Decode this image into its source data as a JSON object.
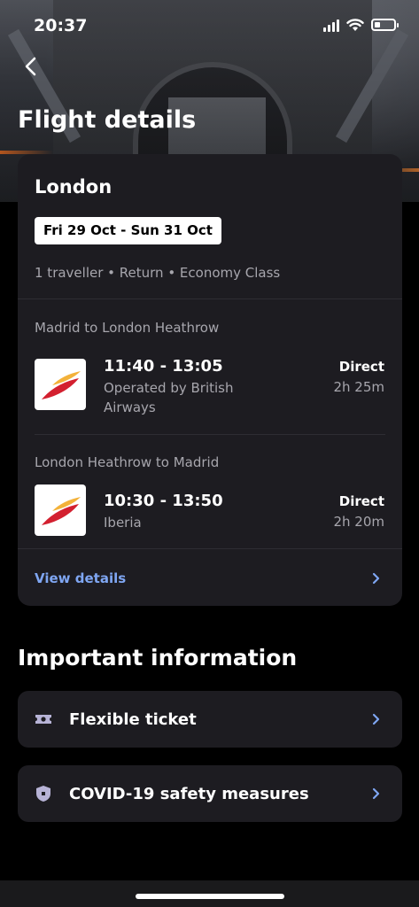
{
  "status_bar": {
    "time": "20:37"
  },
  "header": {
    "title": "Flight details"
  },
  "trip": {
    "city": "London",
    "dates": "Fri 29 Oct - Sun 31 Oct",
    "meta": "1 traveller  •  Return  •  Economy Class"
  },
  "legs": [
    {
      "title": "Madrid to London Heathrow",
      "times": "11:40 - 13:05",
      "carrier": "Operated by British Airways",
      "stops": "Direct",
      "duration": "2h 25m"
    },
    {
      "title": "London Heathrow to Madrid",
      "times": "10:30 - 13:50",
      "carrier": "Iberia",
      "stops": "Direct",
      "duration": "2h 20m"
    }
  ],
  "view_details_label": "View details",
  "important": {
    "title": "Important information",
    "items": [
      {
        "label": "Flexible ticket",
        "icon": "ticket-icon"
      },
      {
        "label": "COVID-19 safety measures",
        "icon": "shield-icon"
      }
    ]
  },
  "colors": {
    "accent_link": "#7fa6f2",
    "card_bg": "#1d1c21",
    "iberia_red": "#d3202f",
    "iberia_yellow": "#f3b23a"
  }
}
